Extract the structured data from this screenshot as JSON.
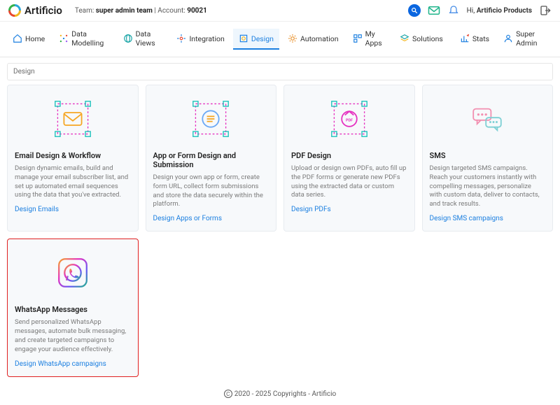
{
  "brand": "Artificio",
  "header": {
    "team_prefix": "Team: ",
    "team_name": "super admin team",
    "account_prefix": " | Account: ",
    "account_id": "90021",
    "greeting_prefix": "Hi, ",
    "greeting_name": "Artificio Products"
  },
  "nav": {
    "home": "Home",
    "data_modelling": "Data Modelling",
    "data_views": "Data Views",
    "integration": "Integration",
    "design": "Design",
    "automation": "Automation",
    "my_apps": "My Apps",
    "solutions": "Solutions",
    "stats": "Stats",
    "super_admin": "Super Admin"
  },
  "breadcrumb": "Design",
  "cards": {
    "email": {
      "title": "Email Design & Workflow",
      "desc": "Design dynamic emails, build and manage your email subscriber list, and set up automated email sequences using the data that you've extracted.",
      "link": "Design Emails"
    },
    "form": {
      "title": "App or Form Design and Submission",
      "desc": "Design your own app or form, create form URL, collect form submissions and store the data securely within the platform.",
      "link": "Design Apps or Forms"
    },
    "pdf": {
      "title": "PDF Design",
      "desc": "Upload or design own PDFs, auto fill up the PDF forms or generate new PDFs using the extracted data or custom data series.",
      "link": "Design PDFs"
    },
    "sms": {
      "title": "SMS",
      "desc": "Design targeted SMS campaigns. Reach your customers instantly with compelling messages, personalize with custom data, deliver to contacts, and track results.",
      "link": "Design SMS campaigns"
    },
    "whatsapp": {
      "title": "WhatsApp Messages",
      "desc": "Send personalized WhatsApp messages, automate bulk messaging, and create targeted campaigns to engage your audience effectively.",
      "link": "Design WhatsApp campaigns"
    }
  },
  "footer": "2020 - 2025 Copyrights - Artificio"
}
